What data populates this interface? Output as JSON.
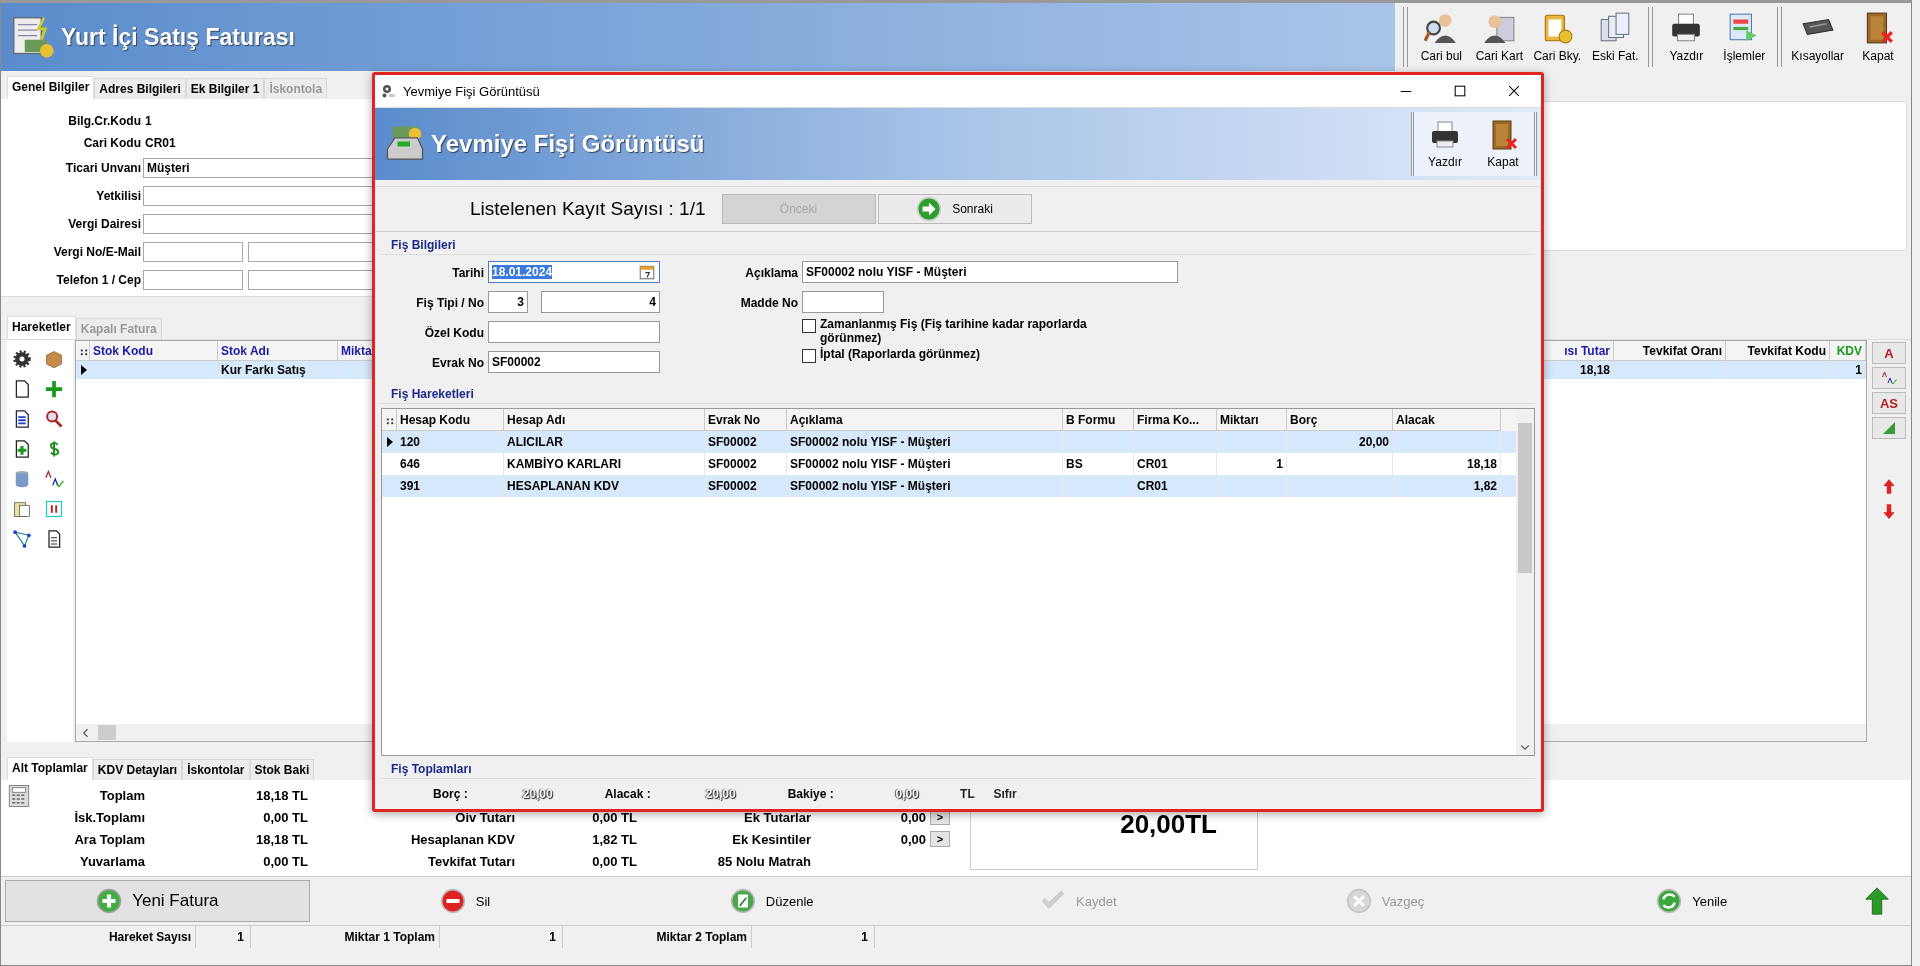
{
  "window": {
    "title": "Yurt İçi Satış Faturası"
  },
  "toolbar": [
    {
      "buttons": [
        {
          "label": "Cari bul",
          "kind": "person-search"
        },
        {
          "label": "Cari Kart",
          "kind": "person-card"
        },
        {
          "label": "Cari Bky.",
          "kind": "clipboard"
        },
        {
          "label": "Eski Fat.",
          "kind": "documents"
        }
      ]
    },
    {
      "buttons": [
        {
          "label": "Yazdır",
          "kind": "print"
        },
        {
          "label": "İşlemler",
          "kind": "forms"
        }
      ]
    },
    {
      "buttons": [
        {
          "label": "Kısayollar",
          "kind": "keyboard"
        },
        {
          "label": "Kapat",
          "kind": "exit"
        }
      ]
    }
  ],
  "tabs": [
    {
      "label": "Genel Bilgiler",
      "selected": true,
      "disabled": false
    },
    {
      "label": "Adres Bilgileri",
      "selected": false,
      "disabled": false
    },
    {
      "label": "Ek Bilgiler 1",
      "selected": false,
      "disabled": false
    },
    {
      "label": "İskontola",
      "selected": false,
      "disabled": true
    }
  ],
  "form": [
    {
      "label": "Bilg.Cr.Kodu",
      "kind": "text",
      "value": "1"
    },
    {
      "label": "Cari Kodu",
      "kind": "text",
      "value": "CR01"
    },
    {
      "label": "Ticari Unvanı",
      "kind": "input",
      "value": "Müşteri"
    },
    {
      "label": "Yetkilisi",
      "kind": "input"
    },
    {
      "label": "Vergi Dairesi",
      "kind": "input"
    },
    {
      "label": "Vergi No/E-Mail",
      "kind": "pair"
    },
    {
      "label": "Telefon 1 / Cep",
      "kind": "pair"
    }
  ],
  "detail_tabs": [
    {
      "label": "Hareketler",
      "selected": true
    },
    {
      "label": "Kapalı Fatura",
      "selected": false
    }
  ],
  "grid": {
    "columns": [
      {
        "label": "Stok Kodu",
        "color": "#1a1aa6"
      },
      {
        "label": "Stok Adı",
        "color": "#1a1aa6"
      },
      {
        "label": "Mikta",
        "color": "#1a1aa6"
      },
      {
        "label": "ısı Tutar",
        "color": "#1a1aa6"
      },
      {
        "label": "Tevkifat Oranı",
        "color": "#000000"
      },
      {
        "label": "Tevkifat Kodu",
        "color": "#000000"
      },
      {
        "label": "KDV",
        "color": "#1a9a1a"
      }
    ],
    "rows": [
      {
        "selected": true,
        "cells": [
          null,
          "Kur Farkı Satış",
          null,
          "18,18",
          null,
          null,
          "1"
        ]
      }
    ]
  },
  "side_buttons": [
    {
      "kind": "text",
      "label": "A"
    },
    {
      "kind": "spell"
    },
    {
      "kind": "text",
      "label": "AS"
    },
    {
      "kind": "corner"
    }
  ],
  "summary_tabs": [
    {
      "label": "Alt Toplamlar",
      "selected": true
    },
    {
      "label": "KDV Detayları",
      "selected": false
    },
    {
      "label": "İskontolar",
      "selected": false
    },
    {
      "label": "Stok Baki",
      "selected": false
    }
  ],
  "totals": {
    "columns": [
      {
        "rows": [
          {
            "label": "Toplam",
            "value": "18,18 TL"
          },
          {
            "label": "İsk.Toplamı",
            "value": "0,00 TL"
          },
          {
            "label": "Ara Toplam",
            "value": "18,18 TL"
          },
          {
            "label": "Yuvarlama",
            "value": "0,00 TL"
          }
        ]
      },
      {
        "rows": [
          {
            "label": "Öiv Tutarı",
            "value": "0,00 TL"
          },
          {
            "label": "Hesaplanan KDV",
            "value": "1,82 TL"
          },
          {
            "label": "Tevkifat Tutarı",
            "value": "0,00 TL"
          }
        ]
      },
      {
        "rows": [
          {
            "label": "Ek Tutarlar",
            "value": "0,00",
            "button": ">"
          },
          {
            "label": "Ek Kesintiler",
            "value": "0,00",
            "button": ">"
          },
          {
            "label": "85 Nolu Matrah"
          }
        ]
      }
    ],
    "grand_total": "20,00TL"
  },
  "actions": [
    {
      "label": "Yeni Fatura",
      "kind": "add",
      "disabled": false,
      "focused": true
    },
    {
      "label": "Sil",
      "kind": "delete",
      "disabled": false,
      "focused": false
    },
    {
      "label": "Düzenle",
      "kind": "edit",
      "disabled": false,
      "focused": false
    },
    {
      "label": "Kaydet",
      "kind": "save",
      "disabled": true,
      "focused": false
    },
    {
      "label": "Vazgeç",
      "kind": "cancel",
      "disabled": true,
      "focused": false
    },
    {
      "label": "Yenile",
      "kind": "refresh",
      "disabled": false,
      "focused": false
    },
    {
      "kind": "up",
      "disabled": false,
      "focused": false
    }
  ],
  "status_bar": [
    {
      "label": "Hareket Sayısı",
      "value": "1"
    },
    {
      "label": "Miktar 1 Toplam",
      "value": "1"
    },
    {
      "label": "Miktar 2 Toplam",
      "value": "1"
    }
  ],
  "dialog": {
    "title": "Yevmiye Fişi Görüntüsü",
    "header": "Yevmiye Fişi Görüntüsü",
    "toolbar": [
      {
        "label": "Yazdır",
        "kind": "print"
      },
      {
        "label": "Kapat",
        "kind": "exit"
      }
    ],
    "record_count": "Listelenen Kayıt Sayısı : 1/1",
    "nav": [
      {
        "label": "Önceki",
        "disabled": true
      },
      {
        "label": "Sonraki",
        "disabled": false
      }
    ],
    "info": {
      "title": "Fiş Bilgileri",
      "date": {
        "label": "Tarihi",
        "value": "18.01.2024"
      },
      "type_no": {
        "label": "Fiş Tipi / No",
        "type": "3",
        "number": "4"
      },
      "special_code": {
        "label": "Özel Kodu"
      },
      "document_no": {
        "label": "Evrak No",
        "value": "SF00002"
      },
      "description": {
        "label": "Açıklama",
        "value": "SF00002 nolu YISF - Müşteri"
      },
      "item_no": {
        "label": "Madde No"
      },
      "checkboxes": [
        {
          "label": "Zamanlanmış Fiş (Fiş tarihine kadar raporlarda görünmez)",
          "checked": false
        },
        {
          "label": "İptal (Raporlarda görünmez)",
          "checked": false
        }
      ]
    },
    "entries": {
      "title": "Fiş Hareketleri",
      "columns": [
        {
          "label": "Hesap Kodu"
        },
        {
          "label": "Hesap Adı"
        },
        {
          "label": "Evrak No"
        },
        {
          "label": "Açıklama"
        },
        {
          "label": "B Formu"
        },
        {
          "label": "Firma Ko..."
        },
        {
          "label": "Miktarı"
        },
        {
          "label": "Borç"
        },
        {
          "label": "Alacak"
        }
      ],
      "rows": [
        {
          "selected": true,
          "current": true,
          "cells": [
            "120",
            "ALICILAR",
            "SF00002",
            "SF00002 nolu YISF - Müşteri",
            null,
            null,
            null,
            "20,00",
            null
          ]
        },
        {
          "selected": false,
          "current": false,
          "cells": [
            "646",
            "KAMBİYO KARLARI",
            "SF00002",
            "SF00002 nolu YISF - Müşteri",
            "BS",
            "CR01",
            "1",
            null,
            "18,18"
          ]
        },
        {
          "selected": true,
          "current": false,
          "cells": [
            "391",
            "HESAPLANAN KDV",
            "SF00002",
            "SF00002 nolu YISF - Müşteri",
            null,
            "CR01",
            null,
            null,
            "1,82"
          ]
        }
      ]
    },
    "totals": {
      "title": "Fiş Toplamları",
      "items": [
        {
          "label": "Borç :",
          "value": "20,00"
        },
        {
          "label": "Alacak :",
          "value": "20,00"
        },
        {
          "label": "Bakiye :",
          "value": "0,00"
        }
      ],
      "currency": "TL",
      "status": "Sıfır"
    }
  }
}
